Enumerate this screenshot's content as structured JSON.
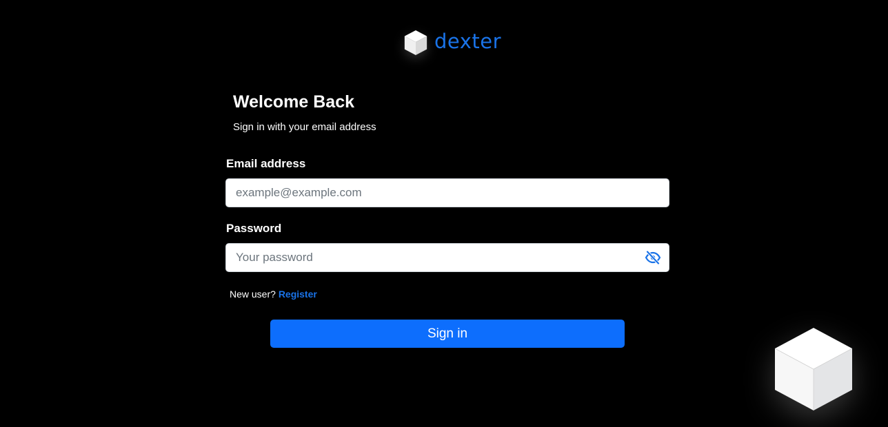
{
  "brand": {
    "name": "dexter",
    "color": "#1a73e8",
    "logo_icon": "cube-icon"
  },
  "heading": {
    "title": "Welcome Back",
    "subtitle": "Sign in with your email address"
  },
  "form": {
    "email": {
      "label": "Email address",
      "placeholder": "example@example.com",
      "value": ""
    },
    "password": {
      "label": "Password",
      "placeholder": "Your password",
      "value": "",
      "toggle_icon": "eye-slash-icon"
    },
    "register": {
      "prompt": "New user?",
      "link_label": "Register"
    },
    "submit_label": "Sign in"
  },
  "colors": {
    "background": "#000000",
    "primary_button": "#0d6efd",
    "link": "#1a73e8"
  },
  "decoration": {
    "icon": "cube-icon"
  }
}
